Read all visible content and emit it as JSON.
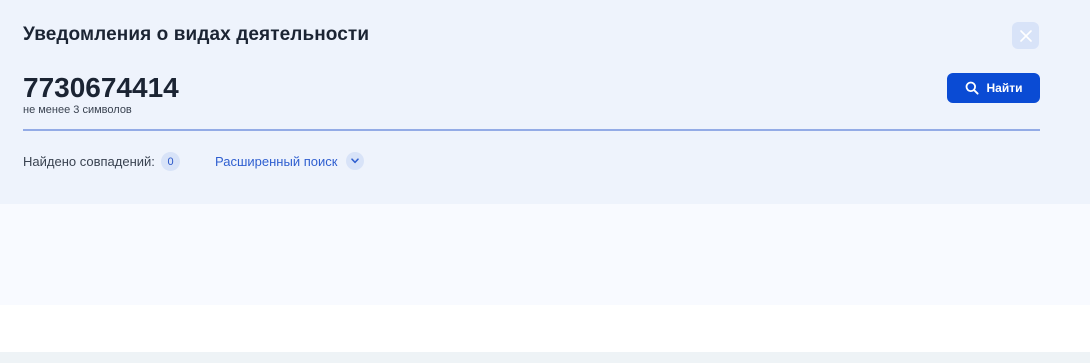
{
  "dialog": {
    "title": "Уведомления о видах деятельности",
    "close_icon": "close-icon"
  },
  "search": {
    "value": "7730674414",
    "hint": "не менее 3 символов",
    "button_label": "Найти",
    "button_icon": "search-icon"
  },
  "results": {
    "found_label": "Найдено совпадений:",
    "count": "0",
    "advanced_search_label": "Расширенный поиск",
    "advanced_icon": "chevron-down-icon"
  },
  "colors": {
    "panel_bg": "#eef3fc",
    "accent": "#0a4bd4",
    "link": "#2f5fd0",
    "badge_bg": "#d8e3f8"
  }
}
